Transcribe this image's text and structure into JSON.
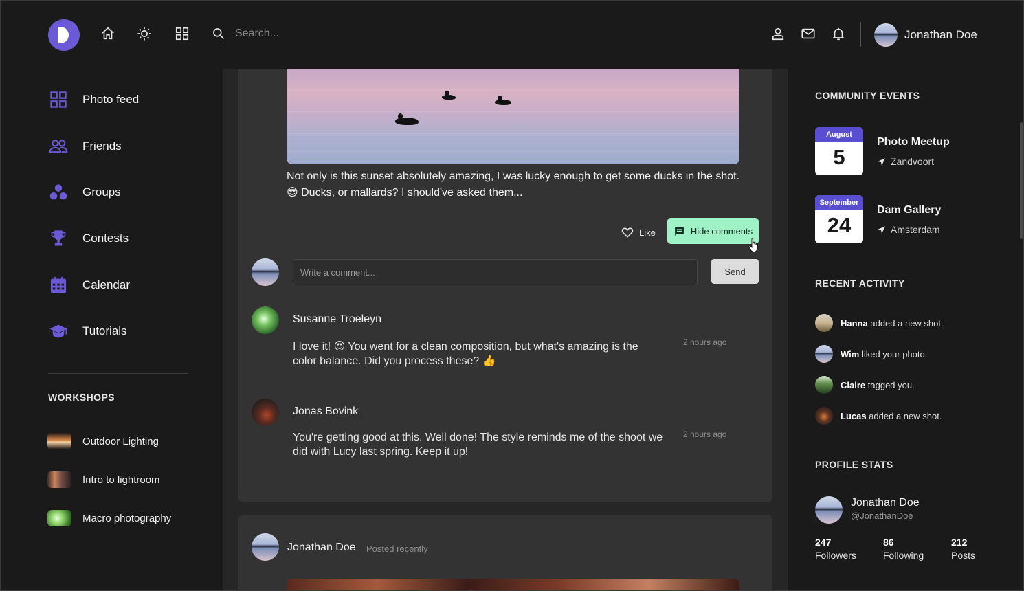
{
  "header": {
    "search_placeholder": "Search...",
    "user_name": "Jonathan Doe",
    "icons": [
      "home-icon",
      "sun-icon",
      "grid-icon",
      "search-icon",
      "user-icon",
      "mail-icon",
      "bell-icon"
    ]
  },
  "sidebar": {
    "items": [
      {
        "label": "Photo feed",
        "icon": "grid-icon"
      },
      {
        "label": "Friends",
        "icon": "users-icon"
      },
      {
        "label": "Groups",
        "icon": "groups-icon"
      },
      {
        "label": "Contests",
        "icon": "trophy-icon"
      },
      {
        "label": "Calendar",
        "icon": "calendar-icon"
      },
      {
        "label": "Tutorials",
        "icon": "graduation-cap-icon"
      }
    ],
    "workshops_title": "WORKSHOPS",
    "workshops": [
      {
        "label": "Outdoor Lighting"
      },
      {
        "label": "Intro to lightroom"
      },
      {
        "label": "Macro photography"
      }
    ]
  },
  "post": {
    "text": "Not only is this sunset absolutely amazing, I was lucky enough to get some ducks in the shot. 😎 Ducks, or mallards? I should've asked them...",
    "like_label": "Like",
    "hide_comments_label": "Hide comments",
    "comment_placeholder": "Write a comment...",
    "send_label": "Send",
    "comments": [
      {
        "name": "Susanne Troeleyn",
        "text": "I love it! 😍 You went for a clean composition, but what's amazing is the color balance. Did you process these? 👍",
        "time": "2 hours ago"
      },
      {
        "name": "Jonas Bovink",
        "text": "You're getting good at this. Well done! The style reminds me of the shoot we did with Lucy last spring. Keep it up!",
        "time": "2 hours ago"
      }
    ]
  },
  "post2": {
    "name": "Jonathan Doe",
    "meta": "Posted recently"
  },
  "right": {
    "events_title": "COMMUNITY EVENTS",
    "events": [
      {
        "month": "August",
        "day": "5",
        "title": "Photo Meetup",
        "location": "Zandvoort"
      },
      {
        "month": "September",
        "day": "24",
        "title": "Dam Gallery",
        "location": "Amsterdam"
      }
    ],
    "activity_title": "RECENT ACTIVITY",
    "activity": [
      {
        "name": "Hanna",
        "action": "added a new shot."
      },
      {
        "name": "Wim",
        "action": "liked your photo."
      },
      {
        "name": "Claire",
        "action": "tagged you."
      },
      {
        "name": "Lucas",
        "action": "added a new shot."
      }
    ],
    "stats_title": "PROFILE STATS",
    "stats_user": {
      "name": "Jonathan Doe",
      "handle": "@JonathanDoe"
    },
    "stats": [
      {
        "value": "247",
        "label": "Followers"
      },
      {
        "value": "86",
        "label": "Following"
      },
      {
        "value": "212",
        "label": "Posts"
      }
    ]
  },
  "colors": {
    "accent": "#6a5ad6",
    "hide_button": "#9ff2c6",
    "background": "#1a1a1a",
    "card": "#333333"
  }
}
